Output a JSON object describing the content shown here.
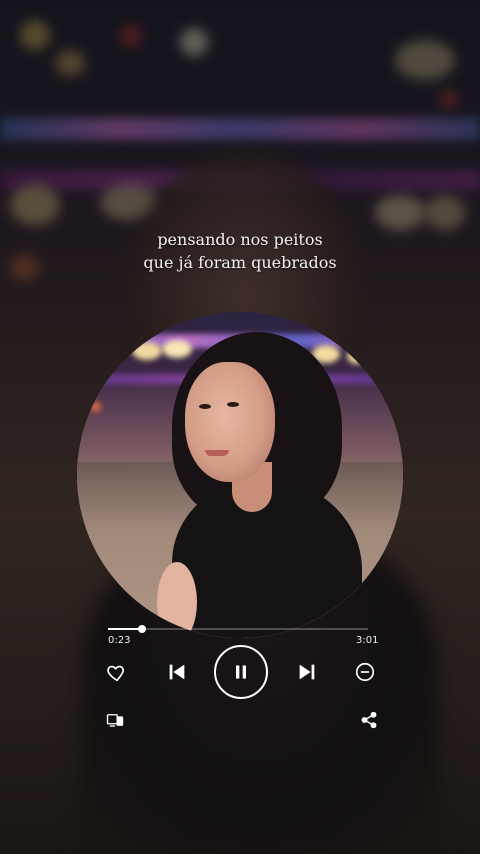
{
  "lyrics": {
    "line1": "pensando nos peitos",
    "line2": "que já foram quebrados"
  },
  "player": {
    "elapsed": "0:23",
    "total": "3:01",
    "progress_fraction": 0.13
  },
  "icons": {
    "heart": "heart-icon",
    "previous": "skip-previous-icon",
    "pause": "pause-icon",
    "next": "skip-next-icon",
    "remove": "minus-circle-icon",
    "devices": "devices-icon",
    "share": "share-icon"
  },
  "colors": {
    "controls": "#ffffff"
  }
}
